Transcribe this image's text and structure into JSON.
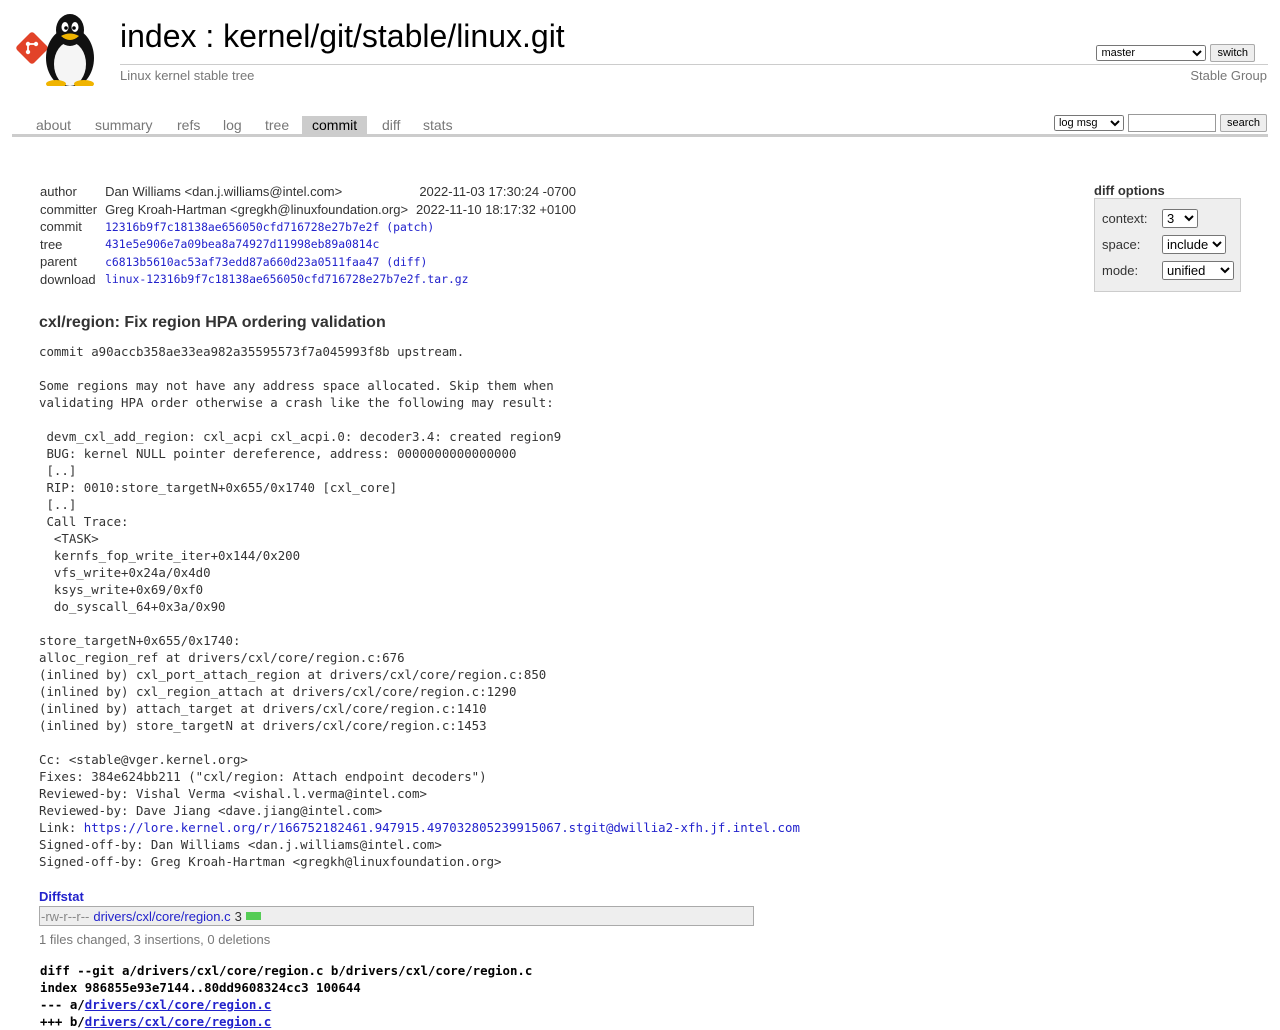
{
  "header": {
    "title_index": "index",
    "title_sep": " : ",
    "title_repo": "kernel/git/stable/linux.git",
    "subtitle": "Linux kernel stable tree",
    "owner": "Stable Group",
    "branch_selected": "master",
    "switch_label": "switch"
  },
  "tabs": [
    {
      "label": "about"
    },
    {
      "label": "summary"
    },
    {
      "label": "refs"
    },
    {
      "label": "log"
    },
    {
      "label": "tree"
    },
    {
      "label": "commit",
      "active": true
    },
    {
      "label": "diff"
    },
    {
      "label": "stats"
    }
  ],
  "search": {
    "scope_selected": "log msg",
    "query": "",
    "button_label": "search"
  },
  "commit_info": {
    "author_label": "author",
    "author": "Dan Williams <dan.j.williams@intel.com>",
    "author_date": "2022-11-03 17:30:24 -0700",
    "committer_label": "committer",
    "committer": "Greg Kroah-Hartman <gregkh@linuxfoundation.org>",
    "committer_date": "2022-11-10 18:17:32 +0100",
    "commit_label": "commit",
    "commit_sha": "12316b9f7c18138ae656050cfd716728e27b7e2f",
    "patch_link": "patch",
    "tree_label": "tree",
    "tree_sha": "431e5e906e7a09bea8a74927d11998eb89a0814c",
    "parent_label": "parent",
    "parent_sha": "c6813b5610ac53af73edd87a660d23a0511faa47",
    "diff_link": "diff",
    "download_label": "download",
    "download_file": "linux-12316b9f7c18138ae656050cfd716728e27b7e2f.tar.gz",
    "open_paren": "(",
    "close_paren": ")"
  },
  "diff_options": {
    "title": "diff options",
    "context_label": "context:",
    "context_value": "3",
    "space_label": "space:",
    "space_value": "include",
    "mode_label": "mode:",
    "mode_value": "unified"
  },
  "subject": "cxl/region: Fix region HPA ordering validation",
  "message_before_link": "commit a90accb358ae33ea982a35595573f7a045993f8b upstream.\n\nSome regions may not have any address space allocated. Skip them when\nvalidating HPA order otherwise a crash like the following may result:\n\n devm_cxl_add_region: cxl_acpi cxl_acpi.0: decoder3.4: created region9\n BUG: kernel NULL pointer dereference, address: 0000000000000000\n [..]\n RIP: 0010:store_targetN+0x655/0x1740 [cxl_core]\n [..]\n Call Trace:\n  <TASK>\n  kernfs_fop_write_iter+0x144/0x200\n  vfs_write+0x24a/0x4d0\n  ksys_write+0x69/0xf0\n  do_syscall_64+0x3a/0x90\n\nstore_targetN+0x655/0x1740:\nalloc_region_ref at drivers/cxl/core/region.c:676\n(inlined by) cxl_port_attach_region at drivers/cxl/core/region.c:850\n(inlined by) cxl_region_attach at drivers/cxl/core/region.c:1290\n(inlined by) attach_target at drivers/cxl/core/region.c:1410\n(inlined by) store_targetN at drivers/cxl/core/region.c:1453\n\nCc: <stable@vger.kernel.org>\nFixes: 384e624bb211 (\"cxl/region: Attach endpoint decoders\")\nReviewed-by: Vishal Verma <vishal.l.verma@intel.com>\nReviewed-by: Dave Jiang <dave.jiang@intel.com>\nLink: ",
  "message_link": "https://lore.kernel.org/r/166752182461.947915.497032805239915067.stgit@dwillia2-xfh.jf.intel.com",
  "message_after_link": "\nSigned-off-by: Dan Williams <dan.j.williams@intel.com>\nSigned-off-by: Greg Kroah-Hartman <gregkh@linuxfoundation.org>",
  "diffstat": {
    "header": "Diffstat",
    "mode": "-rw-r--r--",
    "file": "drivers/cxl/core/region.c",
    "changes": "3",
    "insertions_fraction": 1.0,
    "summary": "1 files changed, 3 insertions, 0 deletions"
  },
  "diff": {
    "line1": "diff --git a/drivers/cxl/core/region.c b/drivers/cxl/core/region.c",
    "line2": "index 986855e93e7144..80dd9608324cc3 100644",
    "line3_prefix": "--- a/",
    "line3_file": "drivers/cxl/core/region.c",
    "line4_prefix": "+++ b/",
    "line4_file": "drivers/cxl/core/region.c"
  },
  "colors": {
    "link": "#2222cc",
    "diffstat_bar": "#55cc55",
    "tab_active_bg": "#cccccc"
  }
}
